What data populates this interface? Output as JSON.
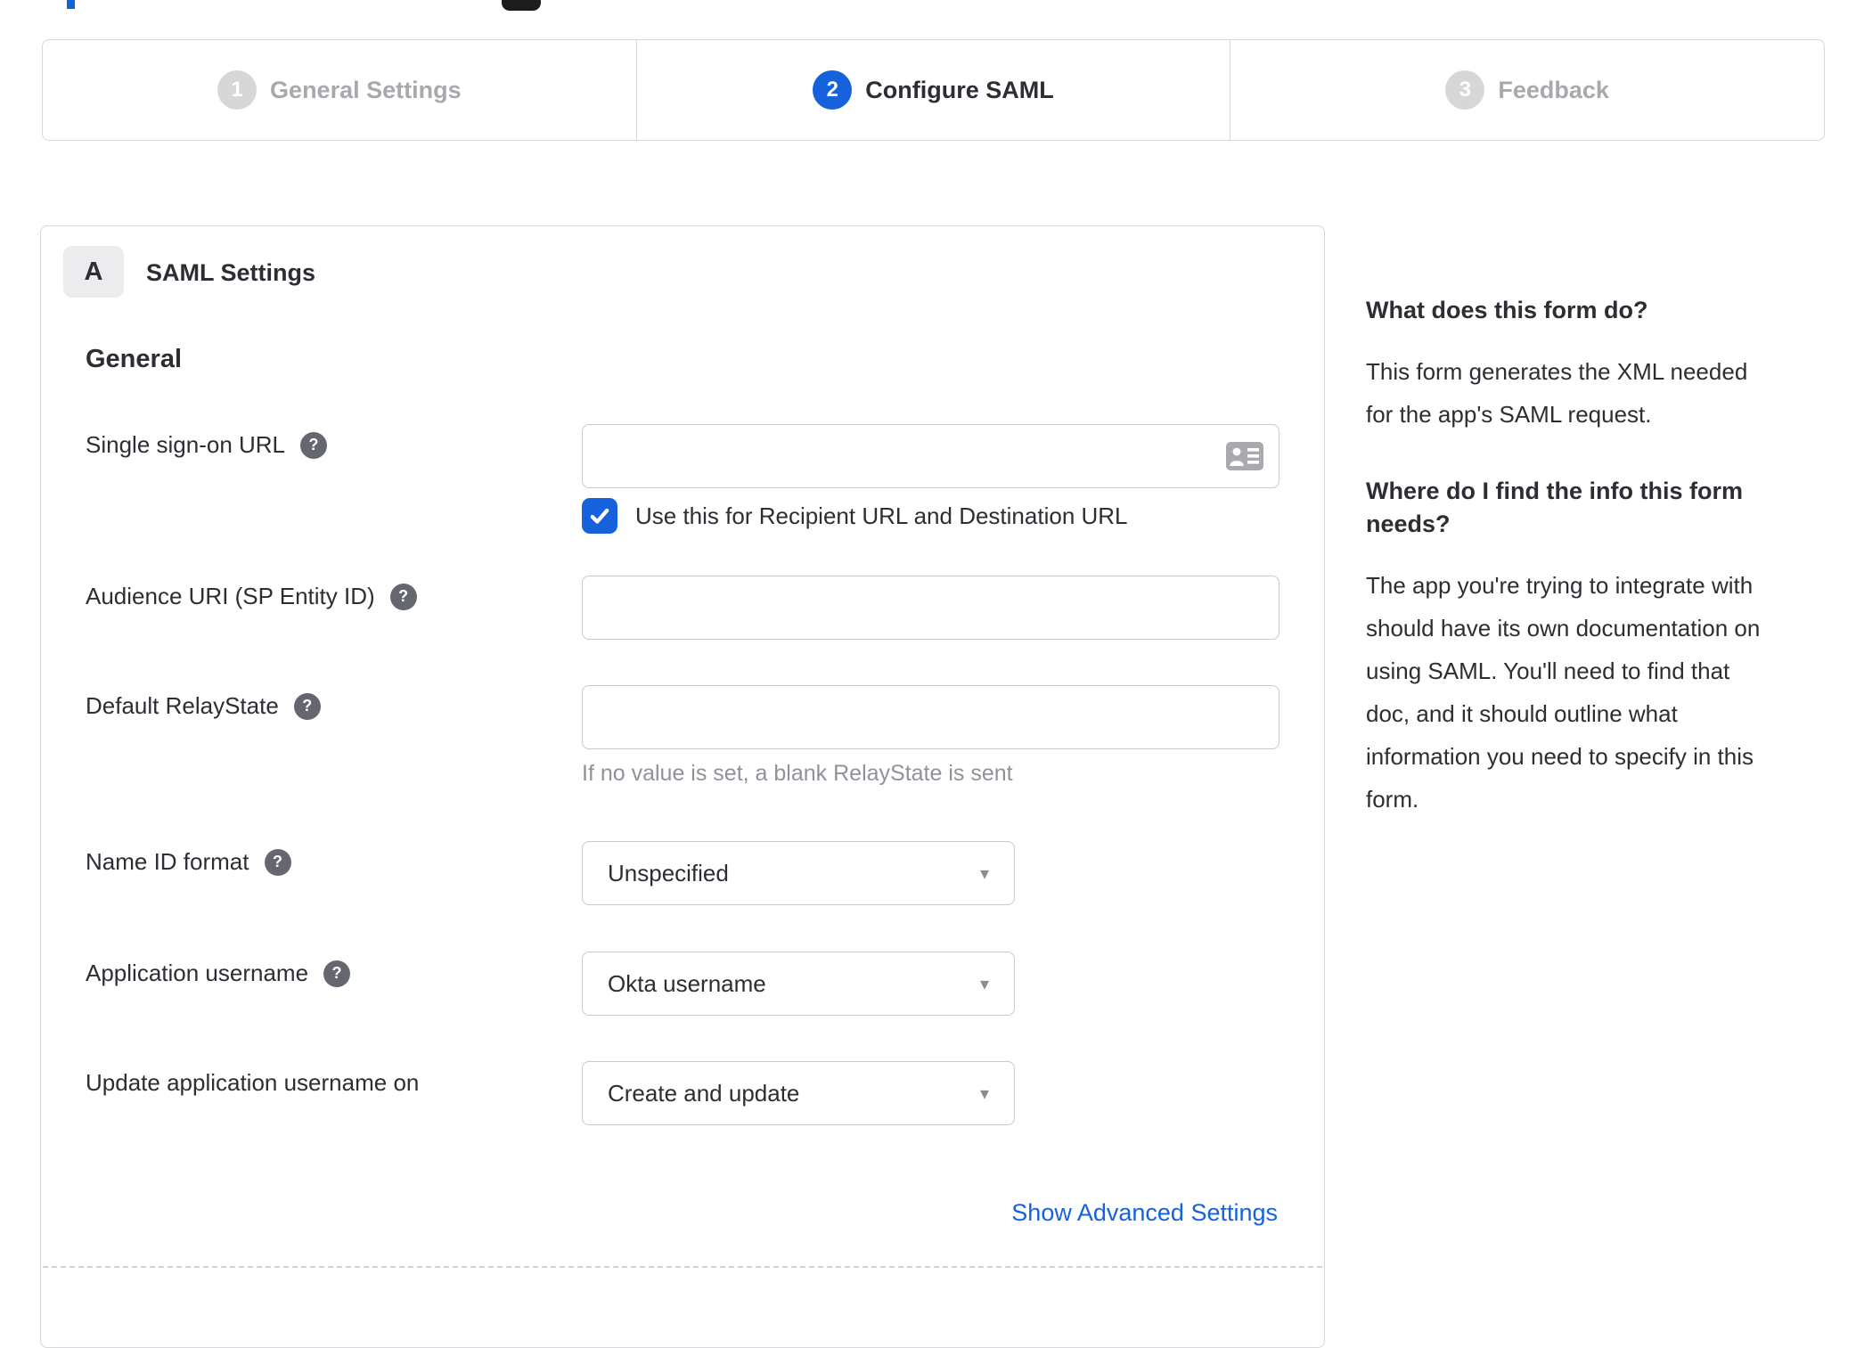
{
  "accent": {
    "blue": "#1662dd"
  },
  "stepper": {
    "steps": [
      {
        "number": "1",
        "label": "General Settings"
      },
      {
        "number": "2",
        "label": "Configure SAML"
      },
      {
        "number": "3",
        "label": "Feedback"
      }
    ]
  },
  "panel": {
    "badge": "A",
    "title": "SAML Settings",
    "group": "General",
    "sso": {
      "label": "Single sign-on URL",
      "value": "",
      "checkbox_label": "Use this for Recipient URL and Destination URL",
      "checked": true
    },
    "audience": {
      "label": "Audience URI (SP Entity ID)",
      "value": ""
    },
    "relay": {
      "label": "Default RelayState",
      "value": "",
      "hint": "If no value is set, a blank RelayState is sent"
    },
    "name_id": {
      "label": "Name ID format",
      "value": "Unspecified"
    },
    "app_username": {
      "label": "Application username",
      "value": "Okta username"
    },
    "update_username": {
      "label": "Update application username on",
      "value": "Create and update"
    },
    "advanced_link": "Show Advanced Settings"
  },
  "icons": {
    "help": "?",
    "dropdown": "▾"
  },
  "sidebar": {
    "q1": "What does this form do?",
    "a1": "This form generates the XML needed\nfor the app's SAML request.",
    "q2": "Where do I find the info this form\nneeds?",
    "a2": "The app you're trying to integrate with\nshould have its own documentation on\nusing SAML. You'll need to find that\ndoc, and it should outline what\ninformation you need to specify in this\nform."
  }
}
